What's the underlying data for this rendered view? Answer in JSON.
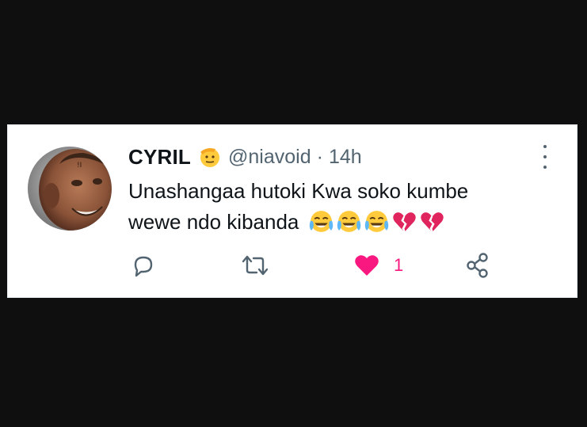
{
  "tweet": {
    "display_name": "CYRIL",
    "name_emoji": "salute-face-emoji",
    "handle": "@niavoid",
    "separator": "·",
    "time": "14h",
    "text_line1": "Unashangaa hutoki Kwa soko kumbe",
    "text_line2": "wewe ndo kibanda",
    "text_emojis": [
      "tears-of-joy-emoji",
      "tears-of-joy-emoji",
      "tears-of-joy-emoji",
      "broken-heart-emoji",
      "broken-heart-emoji"
    ]
  },
  "actions": {
    "reply": {
      "icon": "reply-icon"
    },
    "retweet": {
      "icon": "retweet-icon"
    },
    "like": {
      "icon": "heart-icon",
      "count": "1",
      "liked": true,
      "color": "#f91880"
    },
    "share": {
      "icon": "share-icon"
    }
  },
  "colors": {
    "background": "#0f0f0f",
    "card": "#ffffff",
    "text": "#0f1419",
    "secondary": "#536471",
    "like": "#f91880"
  }
}
